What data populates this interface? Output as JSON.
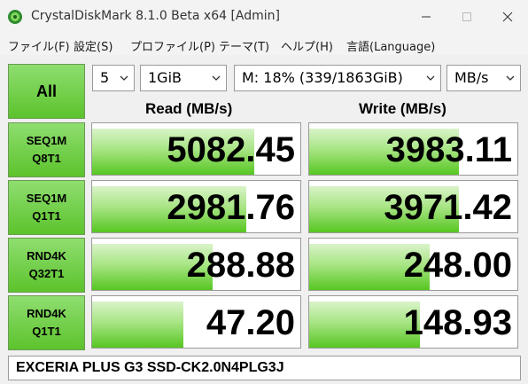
{
  "window": {
    "title": "CrystalDiskMark 8.1.0 Beta x64 [Admin]"
  },
  "menu": [
    {
      "label": "ファイル(F)"
    },
    {
      "label": "設定(S)"
    },
    {
      "label": "プロファイル(P)"
    },
    {
      "label": "テーマ(T)"
    },
    {
      "label": "ヘルプ(H)"
    },
    {
      "label": "言語(Language)"
    }
  ],
  "toolbar": {
    "all_label": "All",
    "count": "5",
    "size": "1GiB",
    "drive": "M: 18% (339/1863GiB)",
    "unit": "MB/s"
  },
  "columns": {
    "read": "Read (MB/s)",
    "write": "Write (MB/s)"
  },
  "tests": [
    {
      "line1": "SEQ1M",
      "line2": "Q8T1",
      "read": "5082.45",
      "write": "3983.11",
      "read_fill": 0.78,
      "write_fill": 0.72
    },
    {
      "line1": "SEQ1M",
      "line2": "Q1T1",
      "read": "2981.76",
      "write": "3971.42",
      "read_fill": 0.74,
      "write_fill": 0.72
    },
    {
      "line1": "RND4K",
      "line2": "Q32T1",
      "read": "288.88",
      "write": "248.00",
      "read_fill": 0.58,
      "write_fill": 0.58
    },
    {
      "line1": "RND4K",
      "line2": "Q1T1",
      "read": "47.20",
      "write": "148.93",
      "read_fill": 0.44,
      "write_fill": 0.53
    }
  ],
  "drive_name": "EXCERIA PLUS G3 SSD-CK2.0N4PLG3J",
  "colors": {
    "accent_green": "#5cc32c",
    "bar_green": "#a8e584"
  }
}
